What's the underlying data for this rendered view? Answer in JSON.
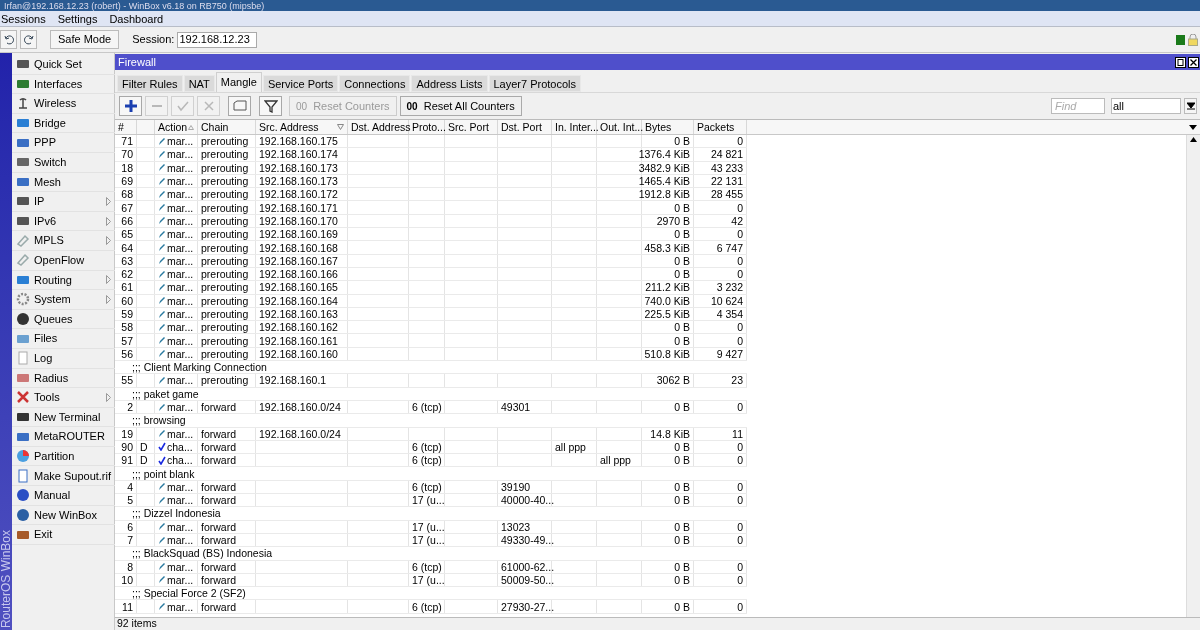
{
  "app_window": {
    "title": "Irfan@192.168.12.23 (robert) - WinBox v6.18 on RB750 (mipsbe)"
  },
  "menu": [
    "Sessions",
    "Settings",
    "Dashboard"
  ],
  "toolbar": {
    "safe_mode": "Safe Mode",
    "session_label": "Session:",
    "session_value": "192.168.12.23"
  },
  "sidebar": {
    "brand": "RouterOS WinBox",
    "items": [
      {
        "label": "Quick Set",
        "submenu": false
      },
      {
        "label": "Interfaces",
        "submenu": false
      },
      {
        "label": "Wireless",
        "submenu": false
      },
      {
        "label": "Bridge",
        "submenu": false
      },
      {
        "label": "PPP",
        "submenu": false
      },
      {
        "label": "Switch",
        "submenu": false
      },
      {
        "label": "Mesh",
        "submenu": false
      },
      {
        "label": "IP",
        "submenu": true
      },
      {
        "label": "IPv6",
        "submenu": true
      },
      {
        "label": "MPLS",
        "submenu": true
      },
      {
        "label": "OpenFlow",
        "submenu": false
      },
      {
        "label": "Routing",
        "submenu": true
      },
      {
        "label": "System",
        "submenu": true
      },
      {
        "label": "Queues",
        "submenu": false
      },
      {
        "label": "Files",
        "submenu": false
      },
      {
        "label": "Log",
        "submenu": false
      },
      {
        "label": "Radius",
        "submenu": false
      },
      {
        "label": "Tools",
        "submenu": true
      },
      {
        "label": "New Terminal",
        "submenu": false
      },
      {
        "label": "MetaROUTER",
        "submenu": false
      },
      {
        "label": "Partition",
        "submenu": false
      },
      {
        "label": "Make Supout.rif",
        "submenu": false
      },
      {
        "label": "Manual",
        "submenu": false
      },
      {
        "label": "New WinBox",
        "submenu": false
      },
      {
        "label": "Exit",
        "submenu": false
      }
    ]
  },
  "firewall": {
    "title": "Firewall",
    "tabs": [
      {
        "label": "Filter Rules",
        "selected": false
      },
      {
        "label": "NAT",
        "selected": false
      },
      {
        "label": "Mangle",
        "selected": true
      },
      {
        "label": "Service Ports",
        "selected": false
      },
      {
        "label": "Connections",
        "selected": false
      },
      {
        "label": "Address Lists",
        "selected": false
      },
      {
        "label": "Layer7 Protocols",
        "selected": false
      }
    ],
    "icon_buttons": [
      {
        "disabled": false
      },
      {
        "disabled": true
      },
      {
        "disabled": true
      },
      {
        "disabled": true
      },
      {
        "disabled": false
      },
      {
        "disabled": false
      }
    ],
    "counter_buttons": [
      {
        "prefix": "00",
        "label": "Reset Counters",
        "disabled": true
      },
      {
        "prefix": "00",
        "label": "Reset All Counters",
        "disabled": false
      }
    ],
    "find": {
      "placeholder": "Find"
    },
    "filter": {
      "value": "all"
    },
    "columns": [
      "#",
      null,
      "Action",
      "Chain",
      "Src. Address",
      "Dst. Address",
      "Proto...",
      "Src. Port",
      "Dst. Port",
      "In. Inter...",
      "Out. Int...",
      "Bytes",
      "Packets"
    ],
    "rows": [
      {
        "kind": "marking",
        "cells": [
          "71",
          null,
          "mar...",
          "prerouting",
          "192.168.160.175",
          null,
          null,
          null,
          null,
          null,
          null,
          "0 B",
          "0"
        ]
      },
      {
        "kind": "marking",
        "cells": [
          "70",
          null,
          "mar...",
          "prerouting",
          "192.168.160.174",
          null,
          null,
          null,
          null,
          null,
          null,
          "1376.4 KiB",
          "24 821"
        ]
      },
      {
        "kind": "marking",
        "cells": [
          "18",
          null,
          "mar...",
          "prerouting",
          "192.168.160.173",
          null,
          null,
          null,
          null,
          null,
          null,
          "3482.9 KiB",
          "43 233"
        ]
      },
      {
        "kind": "marking",
        "cells": [
          "69",
          null,
          "mar...",
          "prerouting",
          "192.168.160.173",
          null,
          null,
          null,
          null,
          null,
          null,
          "1465.4 KiB",
          "22 131"
        ]
      },
      {
        "kind": "marking",
        "cells": [
          "68",
          null,
          "mar...",
          "prerouting",
          "192.168.160.172",
          null,
          null,
          null,
          null,
          null,
          null,
          "1912.8 KiB",
          "28 455"
        ]
      },
      {
        "kind": "marking",
        "cells": [
          "67",
          null,
          "mar...",
          "prerouting",
          "192.168.160.171",
          null,
          null,
          null,
          null,
          null,
          null,
          "0 B",
          "0"
        ]
      },
      {
        "kind": "marking",
        "cells": [
          "66",
          null,
          "mar...",
          "prerouting",
          "192.168.160.170",
          null,
          null,
          null,
          null,
          null,
          null,
          "2970 B",
          "42"
        ]
      },
      {
        "kind": "marking",
        "cells": [
          "65",
          null,
          "mar...",
          "prerouting",
          "192.168.160.169",
          null,
          null,
          null,
          null,
          null,
          null,
          "0 B",
          "0"
        ]
      },
      {
        "kind": "marking",
        "cells": [
          "64",
          null,
          "mar...",
          "prerouting",
          "192.168.160.168",
          null,
          null,
          null,
          null,
          null,
          null,
          "458.3 KiB",
          "6 747"
        ]
      },
      {
        "kind": "marking",
        "cells": [
          "63",
          null,
          "mar...",
          "prerouting",
          "192.168.160.167",
          null,
          null,
          null,
          null,
          null,
          null,
          "0 B",
          "0"
        ]
      },
      {
        "kind": "marking",
        "cells": [
          "62",
          null,
          "mar...",
          "prerouting",
          "192.168.160.166",
          null,
          null,
          null,
          null,
          null,
          null,
          "0 B",
          "0"
        ]
      },
      {
        "kind": "marking",
        "cells": [
          "61",
          null,
          "mar...",
          "prerouting",
          "192.168.160.165",
          null,
          null,
          null,
          null,
          null,
          null,
          "211.2 KiB",
          "3 232"
        ]
      },
      {
        "kind": "marking",
        "cells": [
          "60",
          null,
          "mar...",
          "prerouting",
          "192.168.160.164",
          null,
          null,
          null,
          null,
          null,
          null,
          "740.0 KiB",
          "10 624"
        ]
      },
      {
        "kind": "marking",
        "cells": [
          "59",
          null,
          "mar...",
          "prerouting",
          "192.168.160.163",
          null,
          null,
          null,
          null,
          null,
          null,
          "225.5 KiB",
          "4 354"
        ]
      },
      {
        "kind": "marking",
        "cells": [
          "58",
          null,
          "mar...",
          "prerouting",
          "192.168.160.162",
          null,
          null,
          null,
          null,
          null,
          null,
          "0 B",
          "0"
        ]
      },
      {
        "kind": "marking",
        "cells": [
          "57",
          null,
          "mar...",
          "prerouting",
          "192.168.160.161",
          null,
          null,
          null,
          null,
          null,
          null,
          "0 B",
          "0"
        ]
      },
      {
        "kind": "marking",
        "cells": [
          "56",
          null,
          "mar...",
          "prerouting",
          "192.168.160.160",
          null,
          null,
          null,
          null,
          null,
          null,
          "510.8 KiB",
          "9 427"
        ]
      },
      {
        "kind": "comment",
        "text": ";;; Client Marking Connection"
      },
      {
        "kind": "marking",
        "cells": [
          "55",
          null,
          "mar...",
          "prerouting",
          "192.168.160.1",
          null,
          null,
          null,
          null,
          null,
          null,
          "3062 B",
          "23"
        ]
      },
      {
        "kind": "comment",
        "text": ";;; paket game"
      },
      {
        "kind": "marking",
        "cells": [
          "2",
          null,
          "mar...",
          "forward",
          "192.168.160.0/24",
          null,
          "6 (tcp)",
          null,
          "49301",
          null,
          null,
          "0 B",
          "0"
        ]
      },
      {
        "kind": "comment",
        "text": ";;; browsing"
      },
      {
        "kind": "marking",
        "cells": [
          "19",
          null,
          "mar...",
          "forward",
          "192.168.160.0/24",
          null,
          null,
          null,
          null,
          null,
          null,
          "14.8 KiB",
          "11"
        ]
      },
      {
        "kind": "dynamic",
        "cells": [
          "90",
          "D",
          "cha...",
          "forward",
          null,
          null,
          "6 (tcp)",
          null,
          null,
          "all ppp",
          null,
          "0 B",
          "0"
        ]
      },
      {
        "kind": "dynamic",
        "cells": [
          "91",
          "D",
          "cha...",
          "forward",
          null,
          null,
          "6 (tcp)",
          null,
          null,
          null,
          "all ppp",
          "0 B",
          "0"
        ]
      },
      {
        "kind": "comment",
        "text": ";;; point blank"
      },
      {
        "kind": "marking",
        "cells": [
          "4",
          null,
          "mar...",
          "forward",
          null,
          null,
          "6 (tcp)",
          null,
          "39190",
          null,
          null,
          "0 B",
          "0"
        ]
      },
      {
        "kind": "marking",
        "cells": [
          "5",
          null,
          "mar...",
          "forward",
          null,
          null,
          "17 (u...",
          null,
          "40000-40...",
          null,
          null,
          "0 B",
          "0"
        ]
      },
      {
        "kind": "comment",
        "text": ";;; Dizzel Indonesia"
      },
      {
        "kind": "marking",
        "cells": [
          "6",
          null,
          "mar...",
          "forward",
          null,
          null,
          "17 (u...",
          null,
          "13023",
          null,
          null,
          "0 B",
          "0"
        ]
      },
      {
        "kind": "marking",
        "cells": [
          "7",
          null,
          "mar...",
          "forward",
          null,
          null,
          "17 (u...",
          null,
          "49330-49...",
          null,
          null,
          "0 B",
          "0"
        ]
      },
      {
        "kind": "comment",
        "text": ";;; BlackSquad (BS) Indonesia"
      },
      {
        "kind": "marking",
        "cells": [
          "8",
          null,
          "mar...",
          "forward",
          null,
          null,
          "6 (tcp)",
          null,
          "61000-62...",
          null,
          null,
          "0 B",
          "0"
        ]
      },
      {
        "kind": "marking",
        "cells": [
          "10",
          null,
          "mar...",
          "forward",
          null,
          null,
          "17 (u...",
          null,
          "50009-50...",
          null,
          null,
          "0 B",
          "0"
        ]
      },
      {
        "kind": "comment",
        "text": ";;; Special Force 2 (SF2)"
      },
      {
        "kind": "marking",
        "cells": [
          "11",
          null,
          "mar...",
          "forward",
          null,
          null,
          "6 (tcp)",
          null,
          "27930-27...",
          null,
          null,
          "0 B",
          "0"
        ]
      }
    ],
    "status": "92 items"
  }
}
